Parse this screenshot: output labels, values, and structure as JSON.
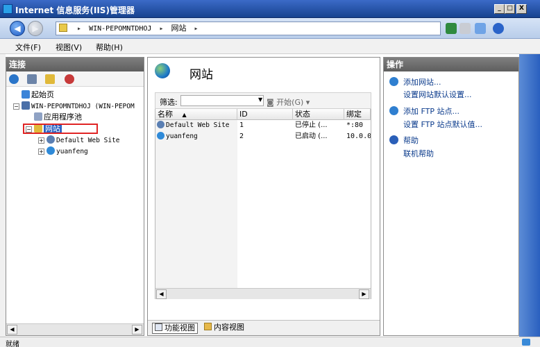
{
  "window": {
    "title": "Internet 信息服务(IIS)管理器",
    "controls": {
      "minimize": "_",
      "maximize": "□",
      "close": "X"
    }
  },
  "addressbar": {
    "path": [
      "WIN-PEPOMNTDHOJ",
      "网站"
    ],
    "separator": "▸"
  },
  "menu": {
    "file": "文件(F)",
    "view": "视图(V)",
    "help": "帮助(H)"
  },
  "connections": {
    "header": "连接",
    "tree": {
      "start_page": "起始页",
      "server": "WIN-PEPOMNTDHOJ (WIN-PEPOM",
      "app_pools": "应用程序池",
      "sites": "网站",
      "site1": "Default Web Site",
      "site2": "yuanfeng"
    },
    "expander_open": "−",
    "expander_closed": "+"
  },
  "center": {
    "title": "网站",
    "filter_label": "筛选:",
    "filter_value": "",
    "filter_go": "开始(G)",
    "columns": [
      "名称",
      "ID",
      "状态",
      "绑定"
    ],
    "sort_indicator": "▲",
    "rows": [
      {
        "name": "Default Web Site",
        "id": "1",
        "status": "已停止 (...",
        "binding": "*:80"
      },
      {
        "name": "yuanfeng",
        "id": "2",
        "status": "已启动 (...",
        "binding": "10.0.0"
      }
    ],
    "tabs": {
      "feature_view": "功能视图",
      "content_view": "内容视图"
    }
  },
  "actions": {
    "header": "操作",
    "add_site": "添加网站...",
    "site_defaults": "设置网站默认设置...",
    "add_ftp": "添加 FTP 站点...",
    "ftp_defaults": "设置 FTP 站点默认值...",
    "help": "帮助",
    "online_help": "联机帮助"
  },
  "status": {
    "text": "就绪"
  },
  "scroll": {
    "left": "◀",
    "right": "▶"
  },
  "colors": {
    "title_bar": "#1e4da3",
    "selection": "#2b62c4",
    "highlight_box": "#e02424",
    "panel_header": "#6b6b6b"
  }
}
